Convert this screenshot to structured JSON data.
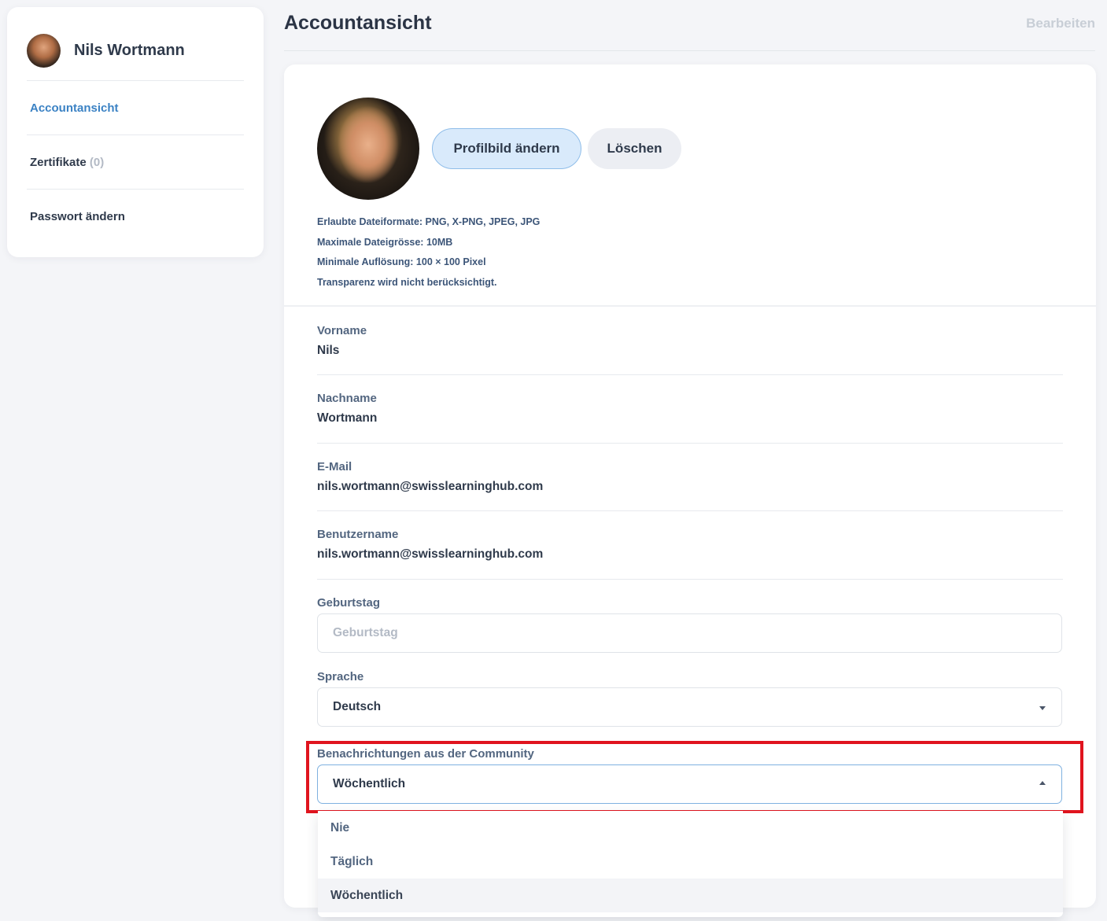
{
  "sidebar": {
    "user_name": "Nils Wortmann",
    "items": [
      {
        "label": "Accountansicht",
        "count": ""
      },
      {
        "label": "Zertifikate",
        "count": "(0)"
      },
      {
        "label": "Passwort ändern",
        "count": ""
      }
    ]
  },
  "header": {
    "title": "Accountansicht",
    "edit_label": "Bearbeiten"
  },
  "profile_picture": {
    "change_label": "Profilbild ändern",
    "delete_label": "Löschen",
    "hints": [
      "Erlaubte Dateiformate: PNG, X-PNG, JPEG, JPG",
      "Maximale Dateigrösse: 10MB",
      "Minimale Auflösung: 100 × 100 Pixel",
      "Transparenz wird nicht berücksichtigt."
    ]
  },
  "fields": {
    "first_name": {
      "label": "Vorname",
      "value": "Nils"
    },
    "last_name": {
      "label": "Nachname",
      "value": "Wortmann"
    },
    "email": {
      "label": "E-Mail",
      "value": "nils.wortmann@swisslearninghub.com"
    },
    "username": {
      "label": "Benutzername",
      "value": "nils.wortmann@swisslearninghub.com"
    },
    "birthday": {
      "label": "Geburtstag",
      "placeholder": "Geburtstag"
    },
    "language": {
      "label": "Sprache",
      "value": "Deutsch"
    },
    "community_notifications": {
      "label": "Benachrichtungen aus der Community",
      "value": "Wöchentlich",
      "options": [
        "Nie",
        "Täglich",
        "Wöchentlich"
      ]
    }
  },
  "colors": {
    "accent": "#3b82c4",
    "highlight": "#e0141e"
  }
}
